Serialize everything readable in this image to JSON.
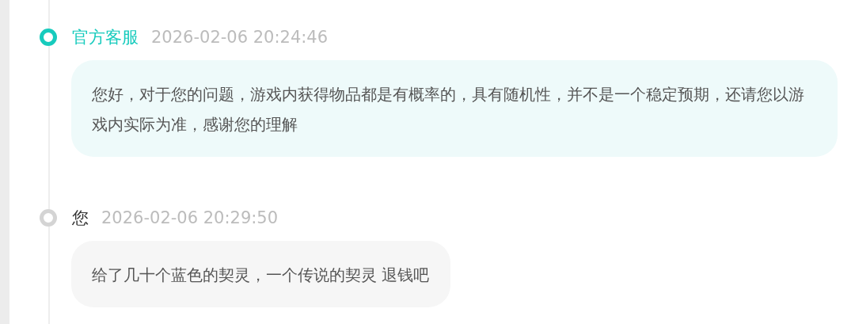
{
  "messages": [
    {
      "kind": "official",
      "sender": "官方客服",
      "time": "2026-02-06 20:24:46",
      "text": "您好，对于您的问题，游戏内获得物品都是有概率的，具有随机性，并不是一个稳定预期，还请您以游戏内实际为准，感谢您的理解"
    },
    {
      "kind": "user",
      "sender": "您",
      "time": "2026-02-06 20:29:50",
      "text": "给了几十个蓝色的契灵，一个传说的契灵 退钱吧"
    }
  ]
}
